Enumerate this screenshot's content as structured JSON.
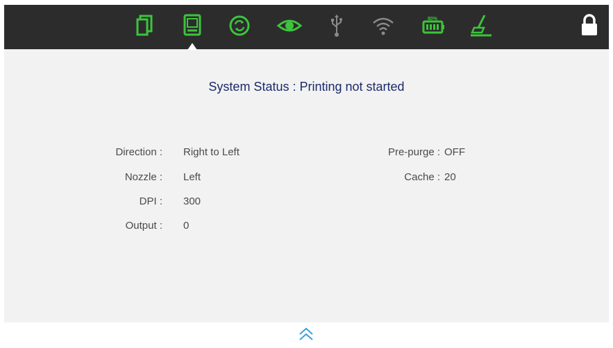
{
  "toolbar": {
    "icons": [
      {
        "name": "documents-icon",
        "color": "#3cc43c"
      },
      {
        "name": "printer-device-icon",
        "color": "#3cc43c",
        "selected": true
      },
      {
        "name": "sync-icon",
        "color": "#3cc43c"
      },
      {
        "name": "eye-icon",
        "color": "#3cc43c"
      },
      {
        "name": "usb-icon",
        "color": "#8a8a8a"
      },
      {
        "name": "wifi-icon",
        "color": "#8a8a8a"
      },
      {
        "name": "battery-icon",
        "color": "#3cc43c",
        "level_text": "80%"
      },
      {
        "name": "cleaning-icon",
        "color": "#3cc43c"
      }
    ],
    "lock": {
      "name": "lock-icon",
      "color": "#ffffff"
    }
  },
  "status": {
    "text": "System Status : Printing not started"
  },
  "info": {
    "direction_label": "Direction :",
    "direction_value": "Right to Left",
    "nozzle_label": "Nozzle :",
    "nozzle_value": "Left",
    "dpi_label": "DPI :",
    "dpi_value": "300",
    "output_label": "Output :",
    "output_value": "0",
    "prepurge_label": "Pre-purge :",
    "prepurge_value": "OFF",
    "cache_label": "Cache :",
    "cache_value": "20"
  },
  "footer": {
    "chevron": {
      "name": "chevron-up-icon",
      "color": "#3aa0d8"
    }
  }
}
